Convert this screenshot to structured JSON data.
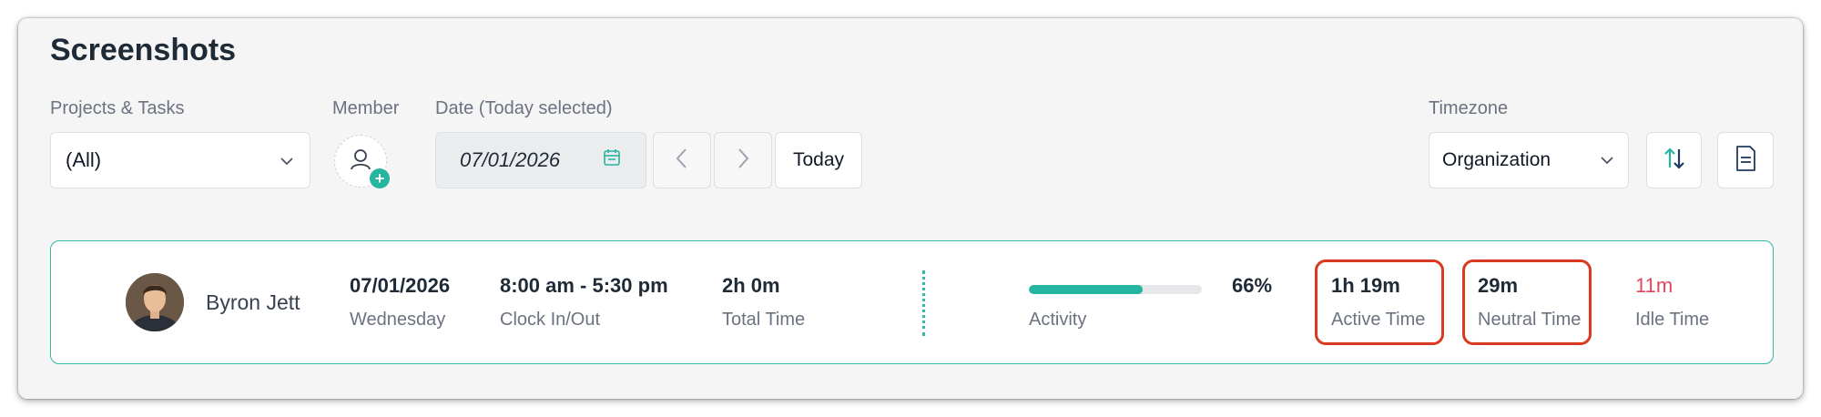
{
  "page": {
    "title": "Screenshots"
  },
  "filters": {
    "projects_label": "Projects & Tasks",
    "projects_value": "(All)",
    "member_label": "Member",
    "date_label": "Date (Today selected)",
    "date_value": "07/01/2026",
    "today_label": "Today",
    "timezone_label": "Timezone",
    "timezone_value": "Organization"
  },
  "record": {
    "name": "Byron Jett",
    "date": "07/01/2026",
    "weekday": "Wednesday",
    "clock": "8:00 am - 5:30 pm",
    "clock_label": "Clock In/Out",
    "total": "2h 0m",
    "total_label": "Total Time",
    "activity_label": "Activity",
    "activity_pct": "66%",
    "activity_fraction": 0.66,
    "active": "1h 19m",
    "active_label": "Active Time",
    "neutral": "29m",
    "neutral_label": "Neutral Time",
    "idle": "11m",
    "idle_label": "Idle Time"
  },
  "colors": {
    "accent": "#26b5a0",
    "idle": "#e0475f",
    "highlight": "#d9391f"
  },
  "icons": [
    "chevron-down-icon",
    "add-member-icon",
    "calendar-icon",
    "chevron-left-icon",
    "chevron-right-icon",
    "sort-icon",
    "export-icon"
  ]
}
